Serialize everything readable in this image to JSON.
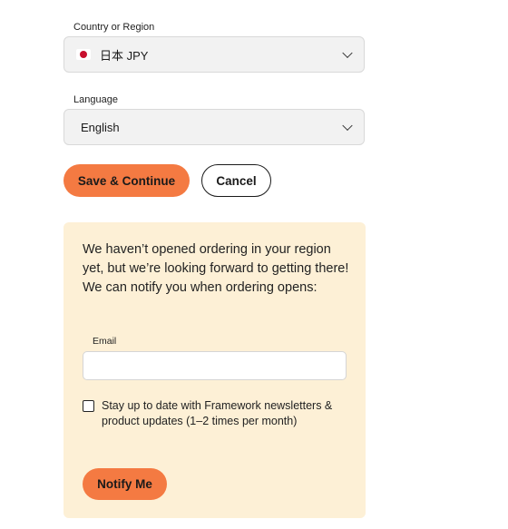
{
  "region": {
    "label": "Country or Region",
    "selected": "日本 JPY",
    "flag_icon": "japan-flag-icon"
  },
  "language": {
    "label": "Language",
    "selected": "English"
  },
  "actions": {
    "save_label": "Save & Continue",
    "cancel_label": "Cancel"
  },
  "notify": {
    "message": "We haven’t opened ordering in your region yet, but we’re looking forward to getting there! We can notify you when ordering opens:",
    "email_label": "Email",
    "email_value": "",
    "newsletter_label": "Stay up to date with Framework newsletters & product updates (1–2 times per month)",
    "newsletter_checked": false,
    "button_label": "Notify Me"
  },
  "colors": {
    "accent": "#f47a42",
    "panel_bg": "#fdf0d6",
    "select_bg": "#f2f2f2"
  }
}
